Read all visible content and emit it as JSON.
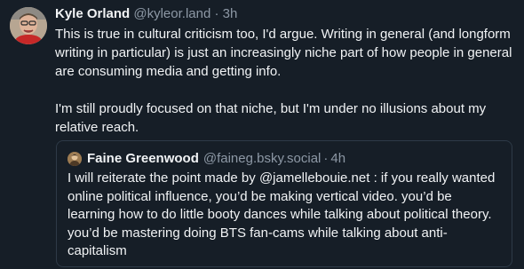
{
  "post": {
    "author": {
      "name": "Kyle Orland",
      "handle": "@kyleor.land",
      "separator": "·",
      "time": "3h",
      "avatar_icon": "user-avatar-icon"
    },
    "paragraphs": [
      "This is true in cultural criticism too, I'd argue. Writing in general (and longform writing in particular) is just an increasingly niche part of how people in general are consuming media and getting info.",
      "I'm still proudly focused on that niche, but I'm under no illusions about my relative reach."
    ]
  },
  "quote": {
    "author": {
      "name": "Faine Greenwood",
      "handle": "@faineg.bsky.social",
      "separator": "·",
      "time": "4h",
      "avatar_icon": "user-avatar-icon"
    },
    "text": "I will reiterate the point made by @jamellebouie.net : if you really wanted online political influence, you’d be making  vertical video. you’d be learning how to do little booty dances while talking about political theory. you’d be mastering doing BTS fan-cams while talking about anti-capitalism"
  },
  "colors": {
    "background": "#161e27",
    "text": "#f1f3f5",
    "muted": "#8d98a5",
    "border": "#2e3a47"
  }
}
